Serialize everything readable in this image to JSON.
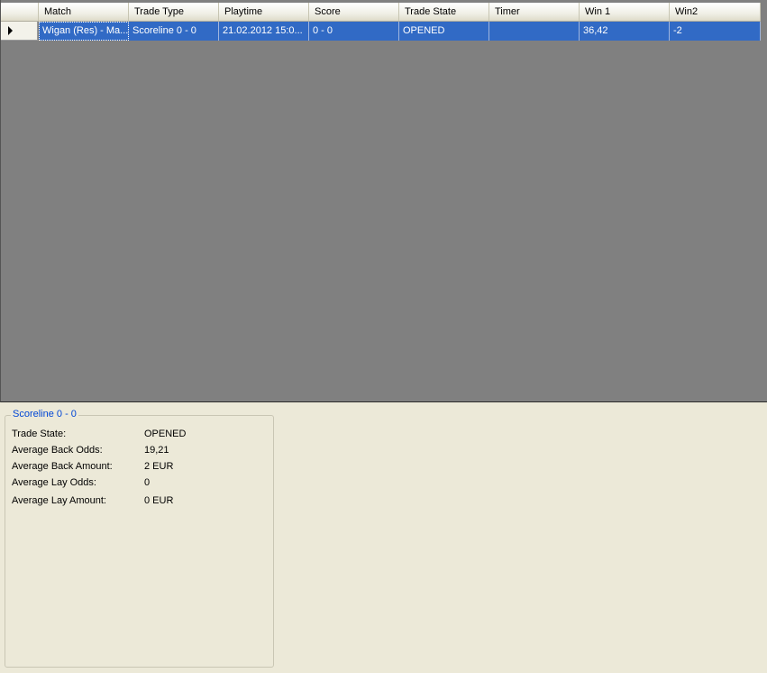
{
  "grid": {
    "columns": [
      "Match",
      "Trade Type",
      "Playtime",
      "Score",
      "Trade State",
      "Timer",
      "Win 1",
      "Win2"
    ],
    "rows": [
      {
        "match": "Wigan (Res) - Ma...",
        "trade_type": "Scoreline 0 - 0",
        "playtime": "21.02.2012 15:0...",
        "score": "0 - 0",
        "trade_state": "OPENED",
        "timer": "",
        "win1": "36,42",
        "win2": "-2"
      }
    ]
  },
  "details": {
    "title": "Scoreline 0 - 0",
    "fields": [
      {
        "label": "Trade State:",
        "value": "OPENED"
      },
      {
        "label": "Average Back Odds:",
        "value": "19,21"
      },
      {
        "label": "Average Back Amount:",
        "value": "2 EUR"
      },
      {
        "label": "Average Lay Odds:",
        "value": "0"
      },
      {
        "label": "Average Lay Amount:",
        "value": "0 EUR"
      }
    ]
  },
  "colors": {
    "selection": "#316AC5",
    "grid_background": "#808080",
    "panel_background": "#ECE9D8",
    "legend_text": "#0046D5"
  }
}
